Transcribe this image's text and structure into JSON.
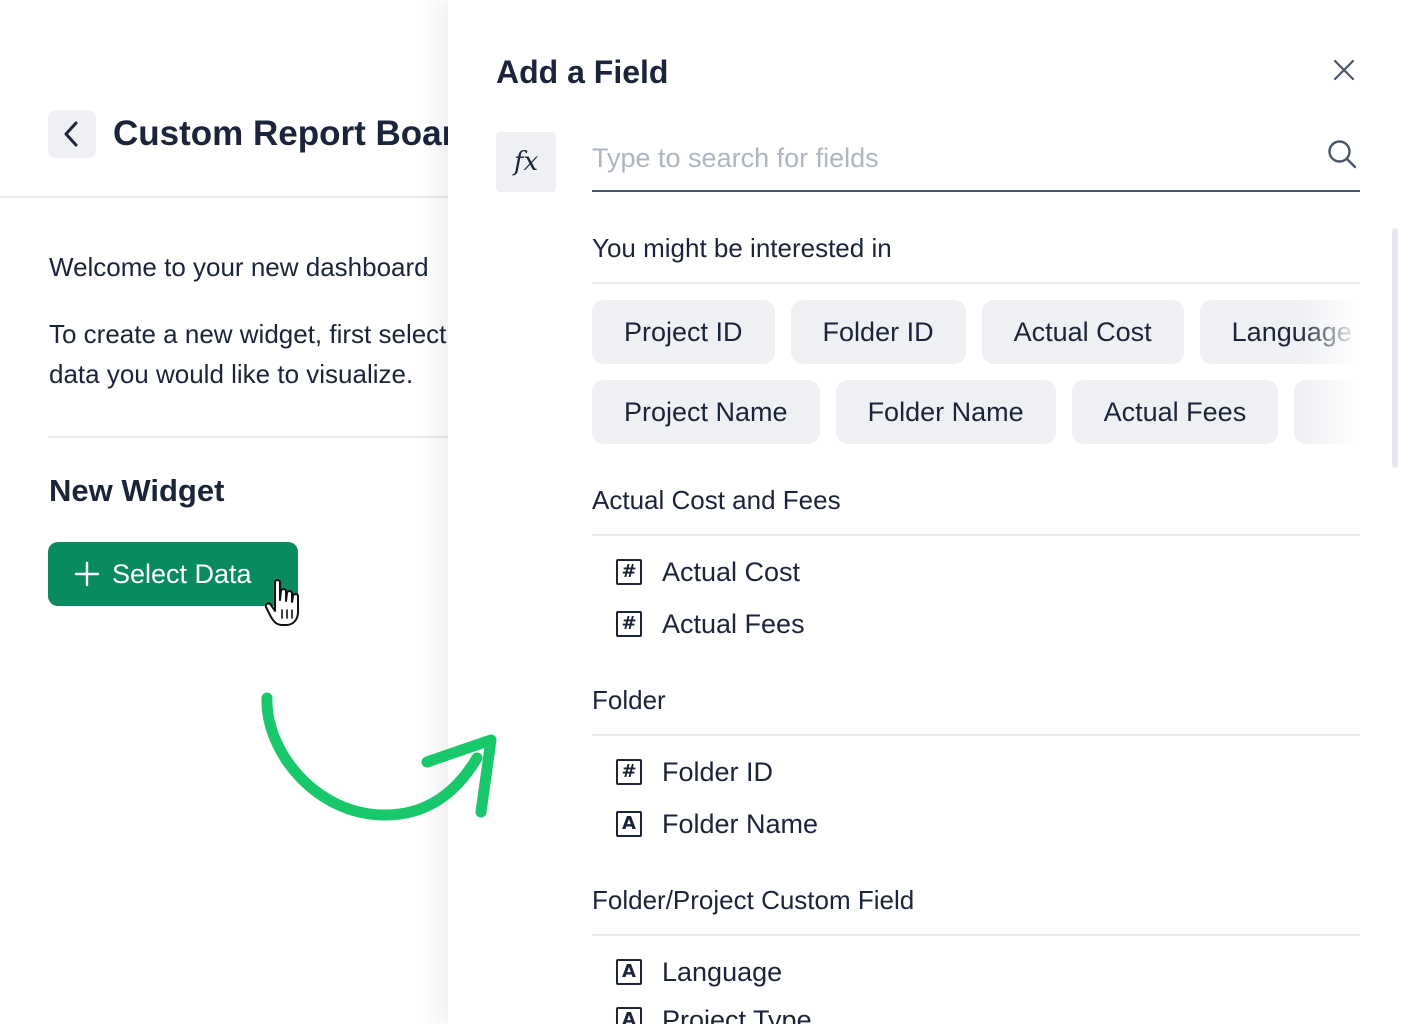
{
  "dashboard": {
    "title": "Custom Report Board",
    "welcome": "Welcome to your new dashboard",
    "instructions_line1": "To create a new widget, first select the",
    "instructions_line2": "data you would like to visualize.",
    "widget_heading": "New Widget",
    "select_data_label": "Select Data"
  },
  "panel": {
    "title": "Add a Field",
    "formula_label": "fx",
    "search": {
      "placeholder": "Type to search for fields",
      "value": ""
    },
    "suggestions": {
      "label": "You might be interested in",
      "row1": [
        "Project ID",
        "Folder ID",
        "Actual Cost",
        "Language"
      ],
      "row2": [
        "Project Name",
        "Folder Name",
        "Actual Fees",
        ""
      ]
    },
    "groups": [
      {
        "label": "Actual Cost and Fees",
        "fields": [
          {
            "icon": "#",
            "label": "Actual Cost"
          },
          {
            "icon": "#",
            "label": "Actual Fees"
          }
        ]
      },
      {
        "label": "Folder",
        "fields": [
          {
            "icon": "#",
            "label": "Folder ID"
          },
          {
            "icon": "A",
            "label": "Folder Name"
          }
        ]
      },
      {
        "label": "Folder/Project Custom Field",
        "fields": [
          {
            "icon": "A",
            "label": "Language"
          },
          {
            "icon": "A",
            "label": "Project Type"
          }
        ]
      }
    ]
  },
  "colors": {
    "accent": "#0a8a5f",
    "arrow": "#19c86a",
    "chip_bg": "#eef0f3",
    "text": "#1b2438"
  },
  "icons": [
    "chevron-left-icon",
    "plus-icon",
    "hand-cursor-icon",
    "close-icon",
    "search-icon",
    "number-type-icon",
    "text-type-icon"
  ]
}
